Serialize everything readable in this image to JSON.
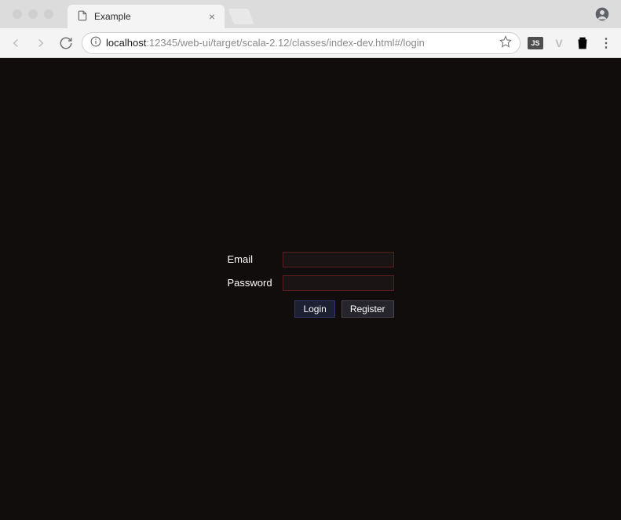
{
  "browser": {
    "tab_title": "Example",
    "url_host": "localhost",
    "url_path": ":12345/web-ui/target/scala-2.12/classes/index-dev.html#/login",
    "ext_js_label": "JS"
  },
  "page": {
    "form": {
      "email_label": "Email",
      "email_value": "",
      "password_label": "Password",
      "password_value": "",
      "login_button": "Login",
      "register_button": "Register"
    }
  },
  "colors": {
    "viewport_bg": "#120d0d",
    "input_border": "#5b1e1e",
    "btn_primary_border": "#32386a"
  }
}
